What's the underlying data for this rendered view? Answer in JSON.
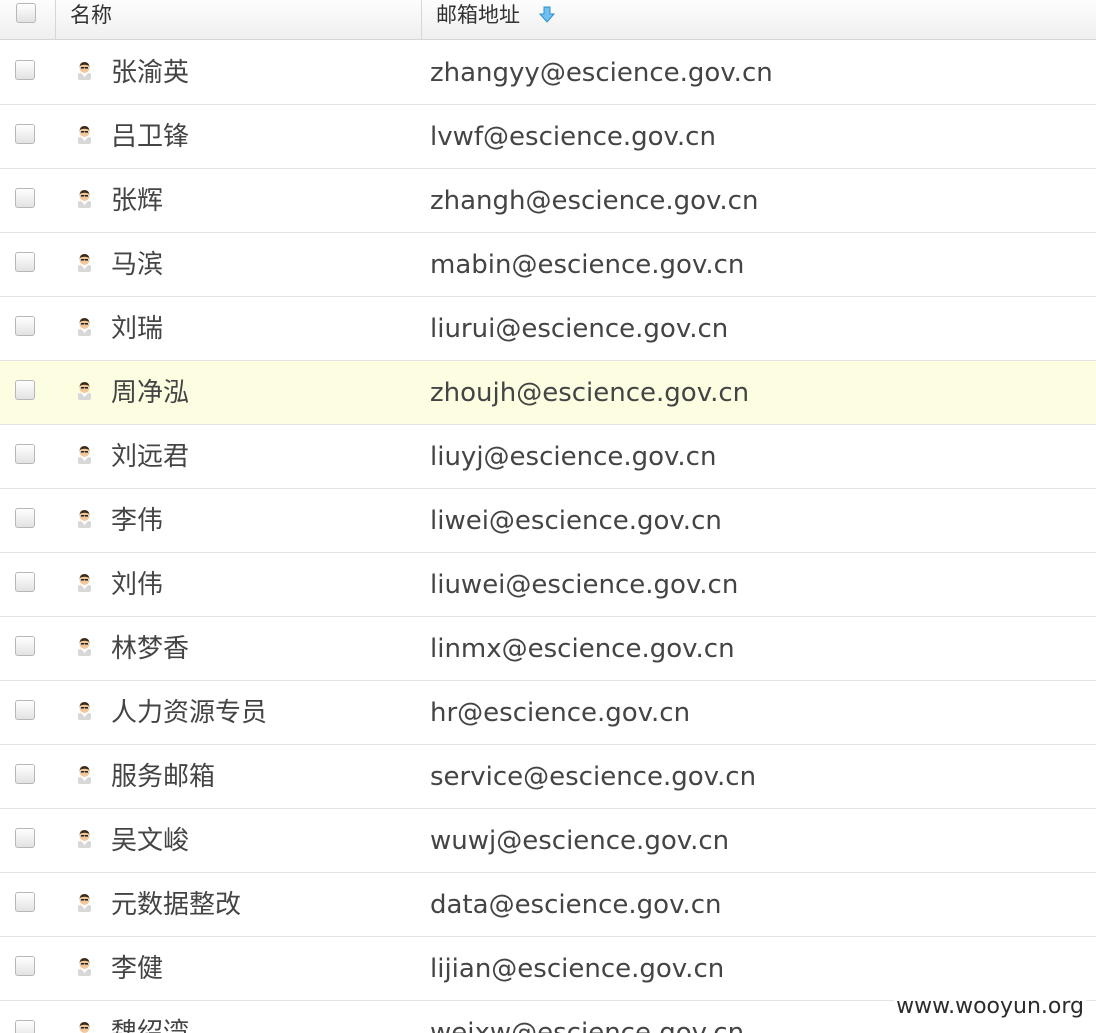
{
  "header": {
    "name_label": "名称",
    "email_label": "邮箱地址",
    "sort_icon": "sort-down-arrow-icon"
  },
  "colors": {
    "highlight_row": "#fdfde2",
    "sort_arrow": "#3a9de0",
    "text": "#444444"
  },
  "contacts": [
    {
      "name": "张渝英",
      "email": "zhangyy@escience.gov.cn"
    },
    {
      "name": "吕卫锋",
      "email": "lvwf@escience.gov.cn"
    },
    {
      "name": "张辉",
      "email": "zhangh@escience.gov.cn"
    },
    {
      "name": "马滨",
      "email": "mabin@escience.gov.cn"
    },
    {
      "name": "刘瑞",
      "email": "liurui@escience.gov.cn"
    },
    {
      "name": "周净泓",
      "email": "zhoujh@escience.gov.cn",
      "highlighted": true
    },
    {
      "name": "刘远君",
      "email": "liuyj@escience.gov.cn"
    },
    {
      "name": "李伟",
      "email": "liwei@escience.gov.cn"
    },
    {
      "name": "刘伟",
      "email": "liuwei@escience.gov.cn"
    },
    {
      "name": "林梦香",
      "email": "linmx@escience.gov.cn"
    },
    {
      "name": "人力资源专员",
      "email": "hr@escience.gov.cn"
    },
    {
      "name": "服务邮箱",
      "email": "service@escience.gov.cn"
    },
    {
      "name": "吴文峻",
      "email": "wuwj@escience.gov.cn"
    },
    {
      "name": "元数据整改",
      "email": "data@escience.gov.cn"
    },
    {
      "name": "李健",
      "email": "lijian@escience.gov.cn"
    },
    {
      "name": "魏绍湾",
      "email": "weixw@escience.gov.cn"
    }
  ],
  "watermark": "www.wooyun.org"
}
